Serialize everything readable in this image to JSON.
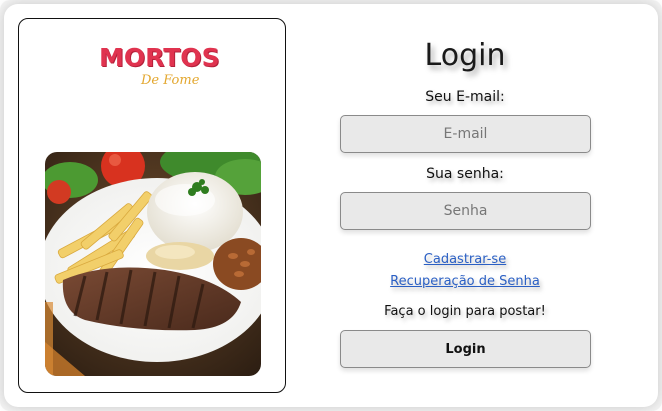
{
  "brand": {
    "logo_main": "MORTOS",
    "logo_sub": "De Fome"
  },
  "login": {
    "title": "Login",
    "email_label": "Seu E-mail:",
    "email_placeholder": "E-mail",
    "email_value": "",
    "password_label": "Sua senha:",
    "password_placeholder": "Senha",
    "password_value": "",
    "register_link": "Cadastrar-se",
    "recover_link": "Recuperação de Senha",
    "hint": "Faça o login para postar!",
    "submit_label": "Login"
  },
  "colors": {
    "logo_red": "#e0334f",
    "logo_gold": "#e3a72f",
    "link_blue": "#2a5fc4",
    "input_bg": "#e9e9e9"
  }
}
